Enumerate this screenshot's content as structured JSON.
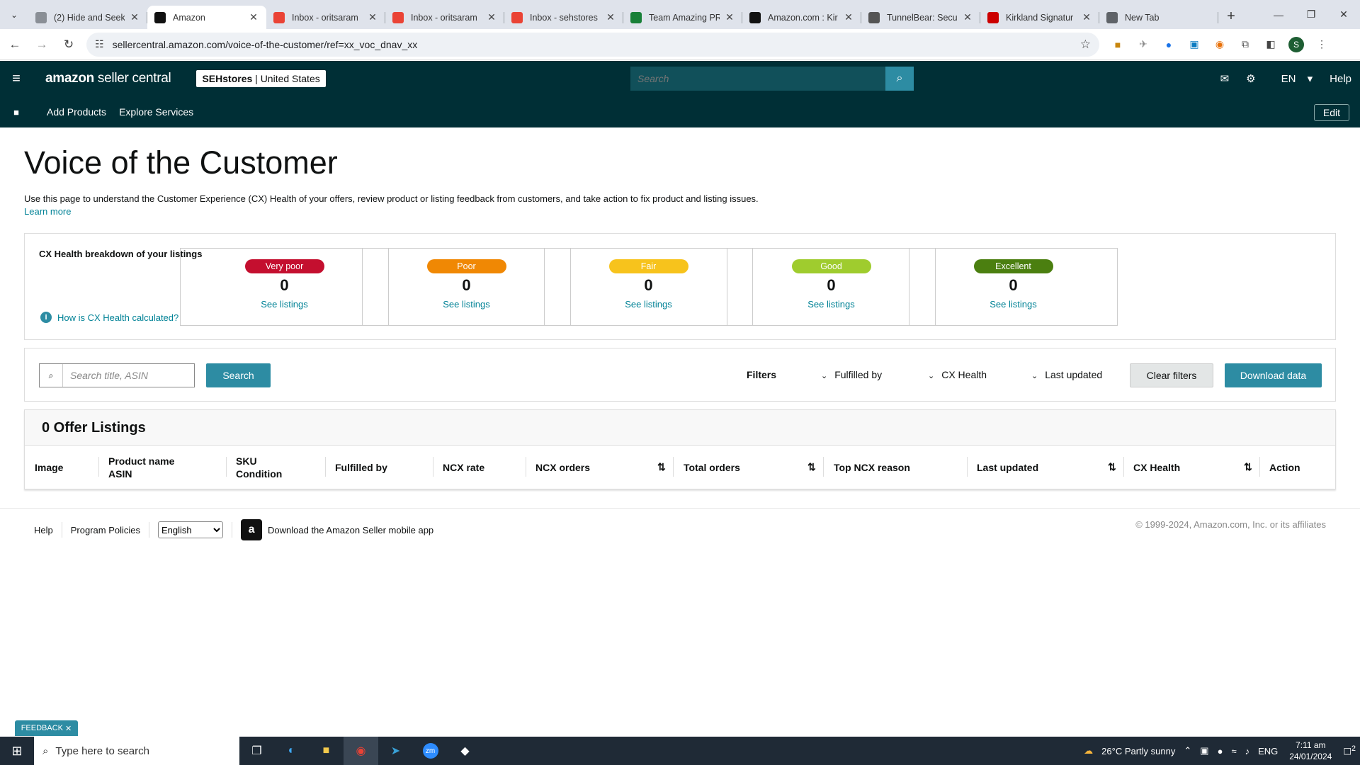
{
  "browser": {
    "tabs": [
      {
        "title": "(2) Hide and Seek",
        "favicon_color": "#8a8f96",
        "favicon": "hide-seek-icon"
      },
      {
        "title": "Amazon",
        "favicon_color": "#111111",
        "favicon": "amazon-icon",
        "active": true
      },
      {
        "title": "Inbox - oritsaram",
        "favicon_color": "#ea4335",
        "favicon": "gmail-icon"
      },
      {
        "title": "Inbox - oritsaram",
        "favicon_color": "#ea4335",
        "favicon": "gmail-icon"
      },
      {
        "title": "Inbox - sehstores",
        "favicon_color": "#ea4335",
        "favicon": "gmail-icon"
      },
      {
        "title": "Team Amazing PR",
        "favicon_color": "#188038",
        "favicon": "sheets-icon"
      },
      {
        "title": "Amazon.com : Kir",
        "favicon_color": "#111111",
        "favicon": "amazon-icon"
      },
      {
        "title": "TunnelBear: Secu",
        "favicon_color": "#555555",
        "favicon": "tunnelbear-icon"
      },
      {
        "title": "Kirkland Signatur",
        "favicon_color": "#cc0000",
        "favicon": "kirkland-icon"
      },
      {
        "title": "New Tab",
        "favicon_color": "#5f6368",
        "favicon": "chrome-icon"
      }
    ],
    "url": "sellercentral.amazon.com/voice-of-the-customer/ref=xx_voc_dnav_xx",
    "profile_initial": "S"
  },
  "header": {
    "logo_bold": "amazon",
    "logo_rest": " seller central",
    "store_name": "SEHstores",
    "store_region": "United States",
    "search_placeholder": "Search",
    "language": "EN",
    "help": "Help"
  },
  "subnav": {
    "items": [
      "Add Products",
      "Explore Services"
    ],
    "edit": "Edit"
  },
  "page": {
    "title": "Voice of the Customer",
    "intro": "Use this page to understand the Customer Experience (CX) Health of your offers, review product or listing feedback from customers, and take action to fix product and listing issues.",
    "learn_more": "Learn more"
  },
  "cx_health": {
    "label": "CX Health breakdown of your listings",
    "how_link": "How is CX Health calculated?",
    "cards": [
      {
        "label": "Very poor",
        "count": "0",
        "link": "See listings",
        "color": "#c40f2f"
      },
      {
        "label": "Poor",
        "count": "0",
        "link": "See listings",
        "color": "#f08804"
      },
      {
        "label": "Fair",
        "count": "0",
        "link": "See listings",
        "color": "#f7c31c"
      },
      {
        "label": "Good",
        "count": "0",
        "link": "See listings",
        "color": "#9fcc2e"
      },
      {
        "label": "Excellent",
        "count": "0",
        "link": "See listings",
        "color": "#4b7f10"
      }
    ]
  },
  "filters": {
    "search_placeholder": "Search title, ASIN",
    "search_button": "Search",
    "filters_label": "Filters",
    "fulfilled_by": "Fulfilled by",
    "cx_health": "CX Health",
    "last_updated": "Last updated",
    "clear": "Clear filters",
    "download": "Download data"
  },
  "listings": {
    "heading": "0 Offer Listings",
    "columns": {
      "image": "Image",
      "product_name": "Product name",
      "asin": "ASIN",
      "sku": "SKU",
      "condition": "Condition",
      "fulfilled_by": "Fulfilled by",
      "ncx_rate": "NCX rate",
      "ncx_orders": "NCX orders",
      "total_orders": "Total orders",
      "top_ncx_reason": "Top NCX reason",
      "last_updated": "Last updated",
      "cx_health": "CX Health",
      "action": "Action"
    }
  },
  "footer": {
    "help": "Help",
    "policies": "Program Policies",
    "language": "English",
    "app": "Download the Amazon Seller mobile app",
    "copyright": "© 1999-2024, Amazon.com, Inc. or its affiliates"
  },
  "feedback": "FEEDBACK",
  "taskbar": {
    "search": "Type here to search",
    "weather": "26°C  Partly sunny",
    "lang": "ENG",
    "time": "7:11 am",
    "date": "24/01/2024",
    "notifications": "2"
  }
}
